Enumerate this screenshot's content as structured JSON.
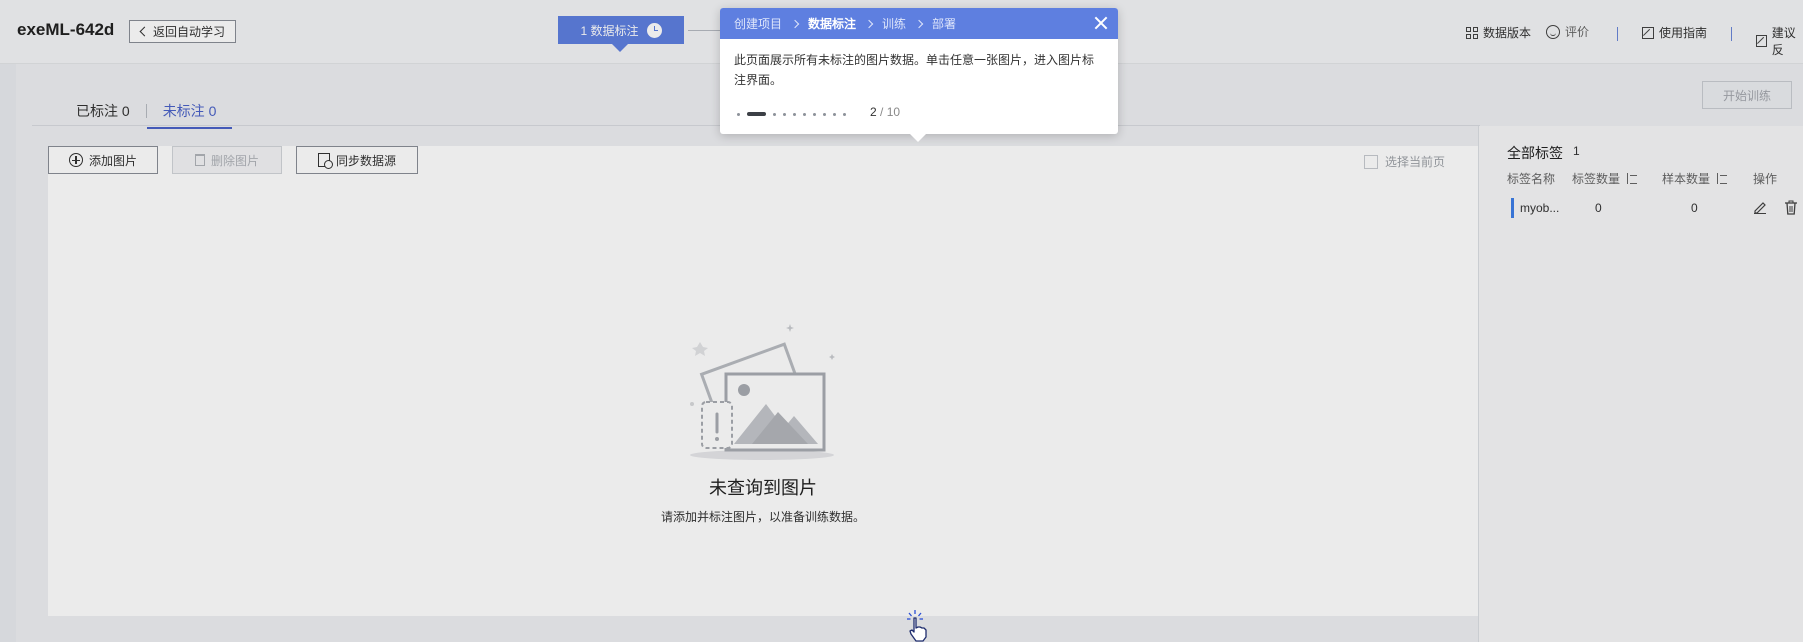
{
  "header": {
    "app_title": "exeML-642d",
    "back_label": "返回自动学习",
    "step_label": "1 数据标注",
    "links": {
      "data_version": "数据版本",
      "rate": "评价",
      "guide": "使用指南",
      "suggest": "建议反"
    }
  },
  "tabs": {
    "labeled": "已标注 0",
    "unlabeled": "未标注 0"
  },
  "start_train_label": "开始训练",
  "toolbar": {
    "add_image": "添加图片",
    "delete_image": "删除图片",
    "sync_source": "同步数据源",
    "select_page": "选择当前页"
  },
  "empty": {
    "title": "未查询到图片",
    "desc": "请添加并标注图片，以准备训练数据。"
  },
  "tags": {
    "title": "全部标签",
    "count": "1",
    "headers": {
      "name": "标签名称",
      "tag_count": "标签数量",
      "sample_count": "样本数量",
      "action": "操作"
    },
    "rows": [
      {
        "name": "myob...",
        "tag_count": "0",
        "sample_count": "0",
        "color": "#3d7ee8"
      }
    ]
  },
  "guide": {
    "crumbs": [
      "创建项目",
      "数据标注",
      "训练",
      "部署"
    ],
    "active_crumb": 1,
    "text": "此页面展示所有未标注的图片数据。单击任意一张图片，进入图片标注界面。",
    "page_current": "2",
    "page_total": " / 10"
  },
  "colors": {
    "accent": "#5e7fe0",
    "tab_active": "#4a62c8",
    "tag_color": "#3d7ee8"
  }
}
